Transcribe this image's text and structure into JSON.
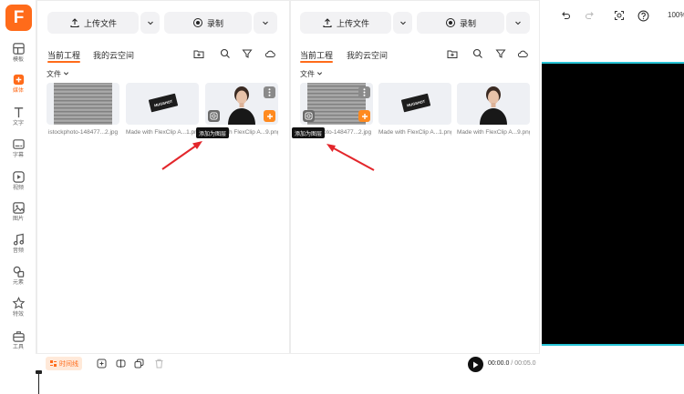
{
  "logo": {
    "letter": "F"
  },
  "rail": [
    {
      "label": "模板",
      "icon": "template-icon"
    },
    {
      "label": "媒体",
      "icon": "media-icon",
      "active": true
    },
    {
      "label": "文字",
      "icon": "text-icon"
    },
    {
      "label": "字幕",
      "icon": "subtitle-icon"
    },
    {
      "label": "视频",
      "icon": "video-icon"
    },
    {
      "label": "图片",
      "icon": "image-icon"
    },
    {
      "label": "音频",
      "icon": "audio-icon"
    },
    {
      "label": "元素",
      "icon": "elements-icon"
    },
    {
      "label": "特效",
      "icon": "effects-icon"
    },
    {
      "label": "工具",
      "icon": "tools-icon"
    }
  ],
  "panel": {
    "upload_label": "上传文件",
    "record_label": "录制",
    "tabs": [
      "当前工程",
      "我的云空间"
    ],
    "filter_label": "文件",
    "tooltip": "添加为图层"
  },
  "panel1_items": [
    {
      "caption": "istockphoto-148477...2.jpg",
      "kind": "shutter"
    },
    {
      "caption": "Made with FlexClip A...1.png",
      "kind": "mugshot"
    },
    {
      "caption": "Made with FlexClip A...9.png",
      "kind": "person"
    }
  ],
  "panel2_items": [
    {
      "caption": "istockphoto-148477...2.jpg",
      "kind": "shutter"
    },
    {
      "caption": "Made with FlexClip A...1.png",
      "kind": "mugshot"
    },
    {
      "caption": "Made with FlexClip A...9.png",
      "kind": "person"
    }
  ],
  "mugshot_text": "MUGSHOT",
  "topbar": {
    "zoom": "100%"
  },
  "bottombar": {
    "timeline_label": "时间线",
    "current_time": "00:00.0",
    "separator": " / ",
    "total_time": "00:05.0"
  },
  "colors": {
    "accent": "#ff6b1a",
    "canvas_border": "#27c4d6",
    "arrow": "#e3262b"
  }
}
